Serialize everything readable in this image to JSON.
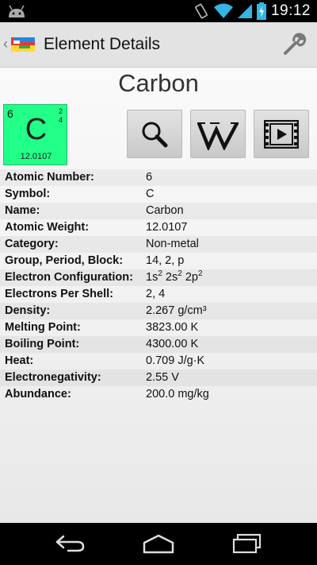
{
  "status_bar": {
    "time": "19:12",
    "icons": [
      "android-icon",
      "vibrate-icon",
      "wifi-icon",
      "signal-icon",
      "battery-charging-icon"
    ]
  },
  "action_bar": {
    "title": "Element Details",
    "icons": [
      "back-icon",
      "app-icon",
      "wrench-icon"
    ]
  },
  "element": {
    "name": "Carbon",
    "tile": {
      "number": "6",
      "symbol": "C",
      "weight": "12.0107",
      "shell_1": "2",
      "shell_2": "4",
      "color": "#22ff88"
    }
  },
  "buttons": {
    "search_icon": "magnifier-icon",
    "wiki_icon": "wikipedia-icon",
    "video_icon": "film-icon"
  },
  "properties": [
    {
      "label": "Atomic Number:",
      "value": "6"
    },
    {
      "label": "Symbol:",
      "value": "C"
    },
    {
      "label": "Name:",
      "value": "Carbon"
    },
    {
      "label": "Atomic Weight:",
      "value": "12.0107"
    },
    {
      "label": "Category:",
      "value": "Non-metal"
    },
    {
      "label": "Group, Period, Block:",
      "value": "14, 2, p"
    },
    {
      "label": "Electron Configuration:",
      "value": "1s2 2s2 2p2",
      "parts": [
        {
          "base": "1s",
          "sup": "2"
        },
        {
          "base": "2s",
          "sup": "2"
        },
        {
          "base": "2p",
          "sup": "2"
        }
      ]
    },
    {
      "label": "Electrons Per Shell:",
      "value": "2, 4"
    },
    {
      "label": "Density:",
      "value": "2.267 g/cm³"
    },
    {
      "label": "Melting Point:",
      "value": "3823.00 K"
    },
    {
      "label": "Boiling Point:",
      "value": "4300.00 K"
    },
    {
      "label": "Heat:",
      "value": "0.709 J/g·K"
    },
    {
      "label": "Electronegativity:",
      "value": "2.55 V"
    },
    {
      "label": "Abundance:",
      "value": "200.0 mg/kg"
    }
  ],
  "nav_bar": {
    "icons": [
      "nav-back-icon",
      "nav-home-icon",
      "nav-recents-icon"
    ]
  }
}
